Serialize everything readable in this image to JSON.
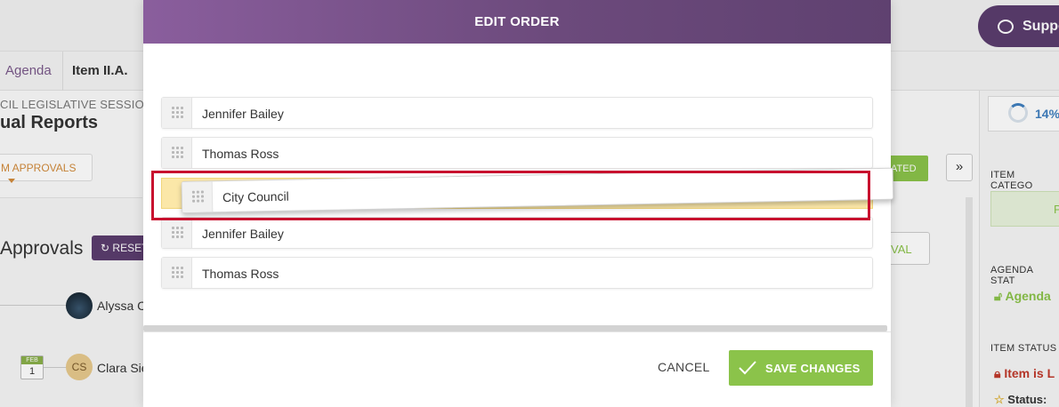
{
  "background": {
    "support_label": "Support",
    "tabs": {
      "agenda": "Agenda",
      "item": "Item II.A."
    },
    "session_subtitle": "CIL LEGISLATIVE SESSION",
    "page_title": "ual Reports",
    "approvals_dropdown": "M APPROVALS",
    "approvals_title": "Approvals",
    "reset_label": "RESET",
    "approvers": [
      {
        "name": "Alyssa C"
      },
      {
        "name": "Clara Sie",
        "initials": "CS",
        "cal_month": "FEB",
        "cal_day": "1"
      }
    ],
    "progress_text": "14%",
    "published_label": "ATED",
    "chevron_label": "»",
    "approval_btn_label": "VAL",
    "item_category_label": "ITEM CATEGO",
    "item_category_value": "P",
    "agenda_status_label": "AGENDA STAT",
    "agenda_status_value": "Agenda",
    "item_status_label": "ITEM STATUS",
    "item_status_value": "Item is L",
    "status_label": "Status:"
  },
  "modal": {
    "title": "EDIT ORDER",
    "rows": [
      {
        "label": "Jennifer Bailey"
      },
      {
        "label": "Thomas Ross"
      },
      {
        "label": "Jennifer Bailey"
      },
      {
        "label": "Thomas Ross"
      }
    ],
    "dragged_row": {
      "label": "City Council"
    },
    "cancel_label": "CANCEL",
    "save_label": "SAVE CHANGES"
  },
  "colors": {
    "header_purple": "#6c4a7c",
    "save_green": "#8bc34a",
    "drop_placeholder": "#fbe7a8",
    "highlight_red": "#c8102e"
  },
  "icons": [
    "drag-handle-icon",
    "check-icon",
    "chat-bubble-icon",
    "progress-ring-icon",
    "lock-icon",
    "star-icon",
    "caret-down-icon",
    "refresh-icon"
  ]
}
